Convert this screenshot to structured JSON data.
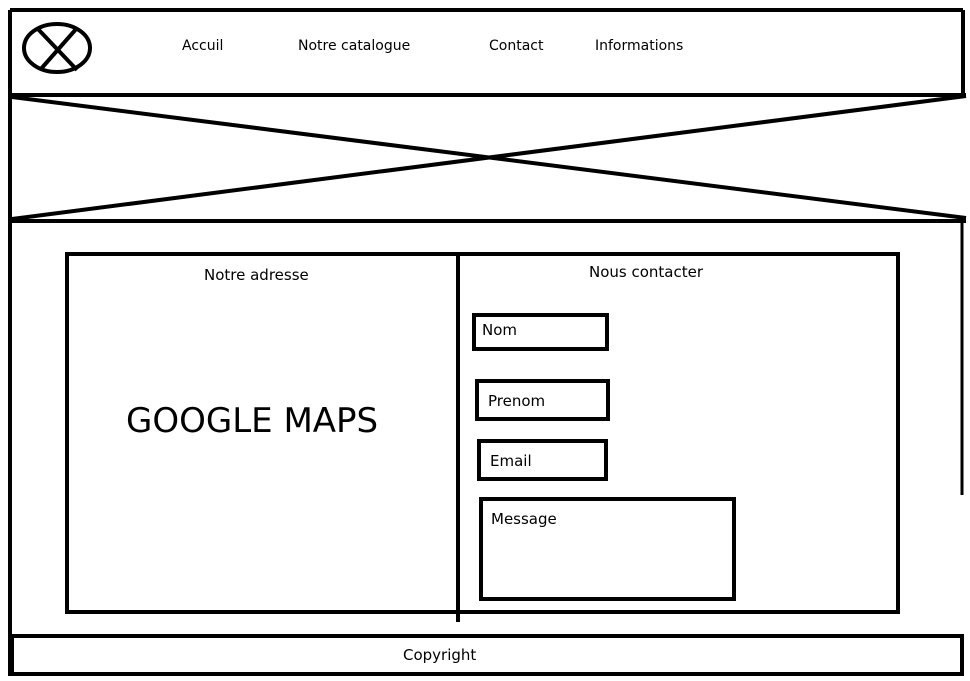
{
  "nav": {
    "items": [
      {
        "label": "Accuil"
      },
      {
        "label": "Notre catalogue"
      },
      {
        "label": "Contact"
      },
      {
        "label": "Informations"
      }
    ]
  },
  "address": {
    "title": "Notre adresse",
    "map_label": "GOOGLE MAPS"
  },
  "contact": {
    "title": "Nous contacter",
    "fields": {
      "nom": "Nom",
      "prenom": "Prenom",
      "email": "Email",
      "message": "Message"
    }
  },
  "footer": {
    "copyright": "Copyright"
  }
}
